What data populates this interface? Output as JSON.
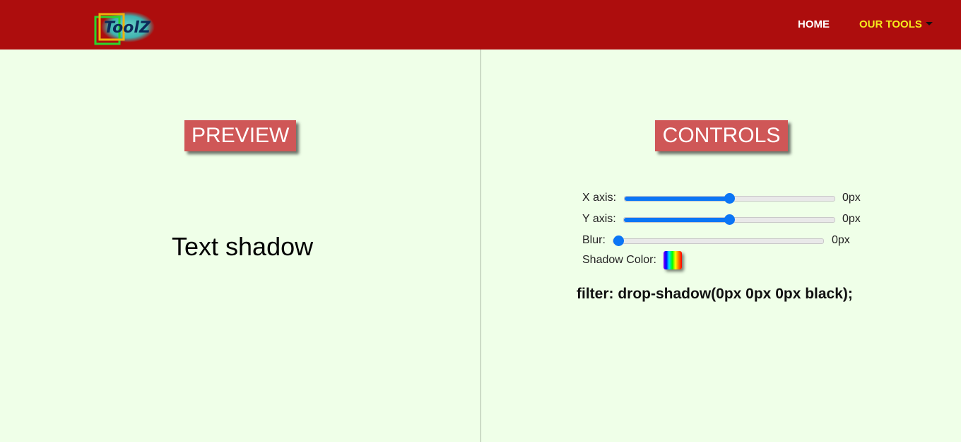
{
  "nav": {
    "logo_text": "ToolZ",
    "home_label": "HOME",
    "tools_label": "OUR TOOLS"
  },
  "preview": {
    "title": "PREVIEW",
    "sample_text": "Text shadow"
  },
  "controls": {
    "title": "CONTROLS",
    "x_axis": {
      "label": "X axis:",
      "value": "0px",
      "position": 0.5
    },
    "y_axis": {
      "label": "Y axis:",
      "value": "0px",
      "position": 0.5
    },
    "blur": {
      "label": "Blur:",
      "value": "0px",
      "position": 0.0
    },
    "shadow_color_label": "Shadow Color:",
    "filter_code": "filter: drop-shadow(0px 0px 0px black);"
  },
  "colors": {
    "navbar": "#ad0d0d",
    "background": "#efffe8",
    "title_bg": "#cf5757",
    "accent_slider": "#0b75f5",
    "tools_link": "#f5ea1c"
  }
}
